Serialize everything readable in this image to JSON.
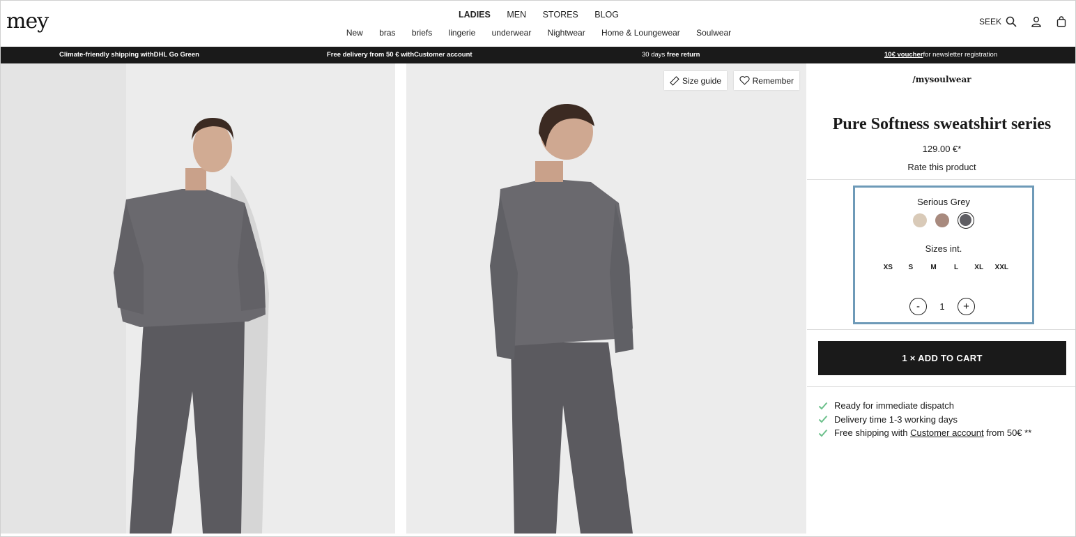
{
  "header": {
    "logo": "mey",
    "main_nav": [
      "LADIES",
      "MEN",
      "STORES",
      "BLOG"
    ],
    "sub_nav": [
      "New",
      "bras",
      "briefs",
      "lingerie",
      "underwear",
      "Nightwear",
      "Home & Loungewear",
      "Soulwear"
    ],
    "search_label": "SEEK"
  },
  "banner": {
    "item1": "Climate-friendly shipping withDHL Go Green",
    "item2": "Free delivery from 50 € withCustomer account",
    "item3_pre": "30 days ",
    "item3_bold": "free return",
    "item4_link": "10€ voucher",
    "item4_rest": "for newsletter registration"
  },
  "gallery": {
    "size_guide": "Size guide",
    "remember": "Remember"
  },
  "product": {
    "brand": "/mysoulwear",
    "title": "Pure Softness sweatshirt series",
    "price": "129.00 €*",
    "rate": "Rate this product",
    "color_name": "Serious Grey",
    "swatches": [
      "#d9cab8",
      "#a88a7e",
      "#5f5e63"
    ],
    "sizes_label": "Sizes int.",
    "sizes": [
      "XS",
      "S",
      "M",
      "L",
      "XL",
      "XXL"
    ],
    "qty_minus": "-",
    "qty_value": "1",
    "qty_plus": "+",
    "add_to_cart": "1 × ADD TO CART"
  },
  "checks": {
    "c1": "Ready for immediate dispatch",
    "c2": "Delivery time 1-3 working days",
    "c3_pre": "Free shipping with ",
    "c3_link": "Customer account",
    "c3_post": " from 50€ **"
  },
  "colors": {
    "accent_border": "#6e9ab8",
    "check_green": "#6cc08b",
    "dark": "#1a1a1a"
  }
}
